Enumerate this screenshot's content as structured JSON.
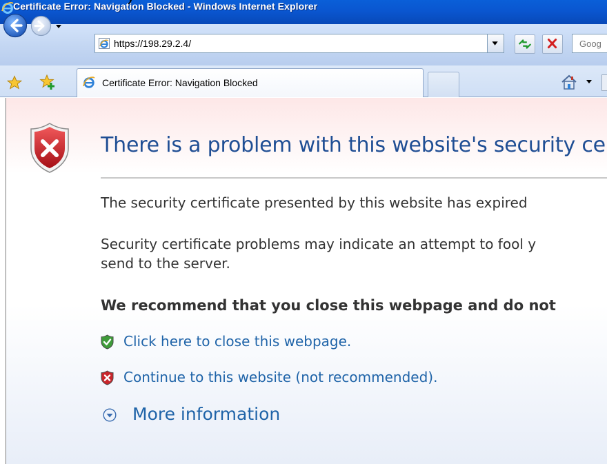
{
  "window": {
    "title": "Certificate Error: Navigation Blocked - Windows Internet Explorer",
    "overlay_fragment": "y"
  },
  "toolbar": {
    "address_url": "https://198.29.2.4/",
    "search_placeholder": "Goog"
  },
  "tabs": [
    {
      "label": "Certificate Error: Navigation Blocked",
      "active": true,
      "icon": "ie-icon"
    }
  ],
  "page": {
    "title": "There is a problem with this website's security ce",
    "paragraph1": "The security certificate presented by this website has expired",
    "paragraph2_line1": "Security certificate problems may indicate an attempt to fool y",
    "paragraph2_line2": "send to the server.",
    "recommendation": "We recommend that you close this webpage and do not",
    "close_link": "Click here to close this webpage.",
    "continue_link": "Continue to this website (not recommended).",
    "more_info": "More information"
  },
  "colors": {
    "title_blue": "#1f4e94",
    "link_blue": "#1e63a8",
    "titlebar_blue": "#0a56d0",
    "danger_red": "#c6191f",
    "safe_green": "#2e8b2e"
  }
}
